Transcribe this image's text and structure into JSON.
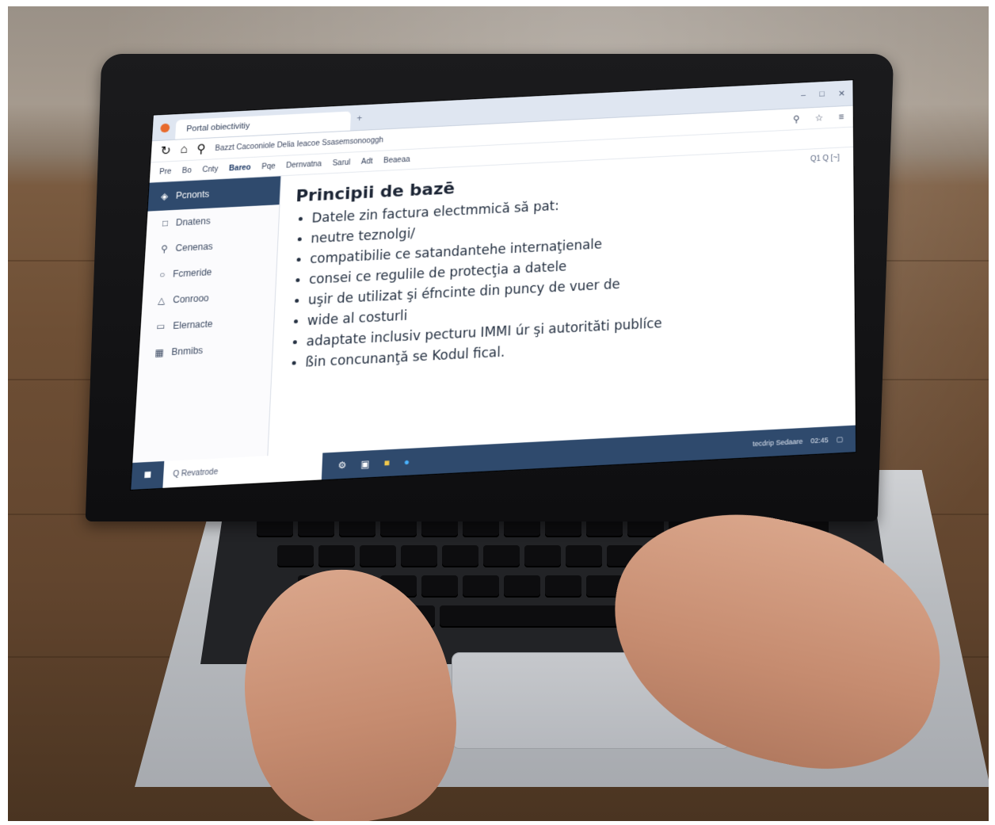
{
  "browser": {
    "tab_title": "Portal obiectivitiy",
    "address": "Bazzt Cacooniole Delia Ieacoe  Ssasemsonooggh"
  },
  "toolbar": {
    "items": [
      "Pre",
      "Bo",
      "Cnty",
      "Bareo",
      "Pqe",
      "Dernvatna",
      "Sarul",
      "Adt",
      "Beaeaa"
    ]
  },
  "sidebar": {
    "header": "Pcnonts",
    "items": [
      "Dnatens",
      "Cenenas",
      "Fcmeride",
      "Conrooo",
      "Elernacte",
      "Bnmibs"
    ]
  },
  "content": {
    "zoom": "Q1 Q [~]",
    "title": "Principii de bazē",
    "bullets": [
      "Datele zin factura electmmică să pat:",
      "neutre teznolgi/",
      "compatibilie ce satandantehe internaţienale",
      "consei ce regulile de protecţia a datele",
      "uşir de utilizat şi éfncinte din puncy de vuer de",
      "wide al costurli",
      "adaptate inclusiv pecturu IMMI úr şi autorităti publíce",
      "ßin concunanţă se Kodul fical."
    ]
  },
  "taskbar": {
    "search": "Q Revatrode",
    "tray_text": "tecdrip Sedaare",
    "clock": "02:45"
  },
  "colors": {
    "accent": "#2f4a6d",
    "tab_bar": "#dfe6f1",
    "wood": "#6e4f35"
  }
}
